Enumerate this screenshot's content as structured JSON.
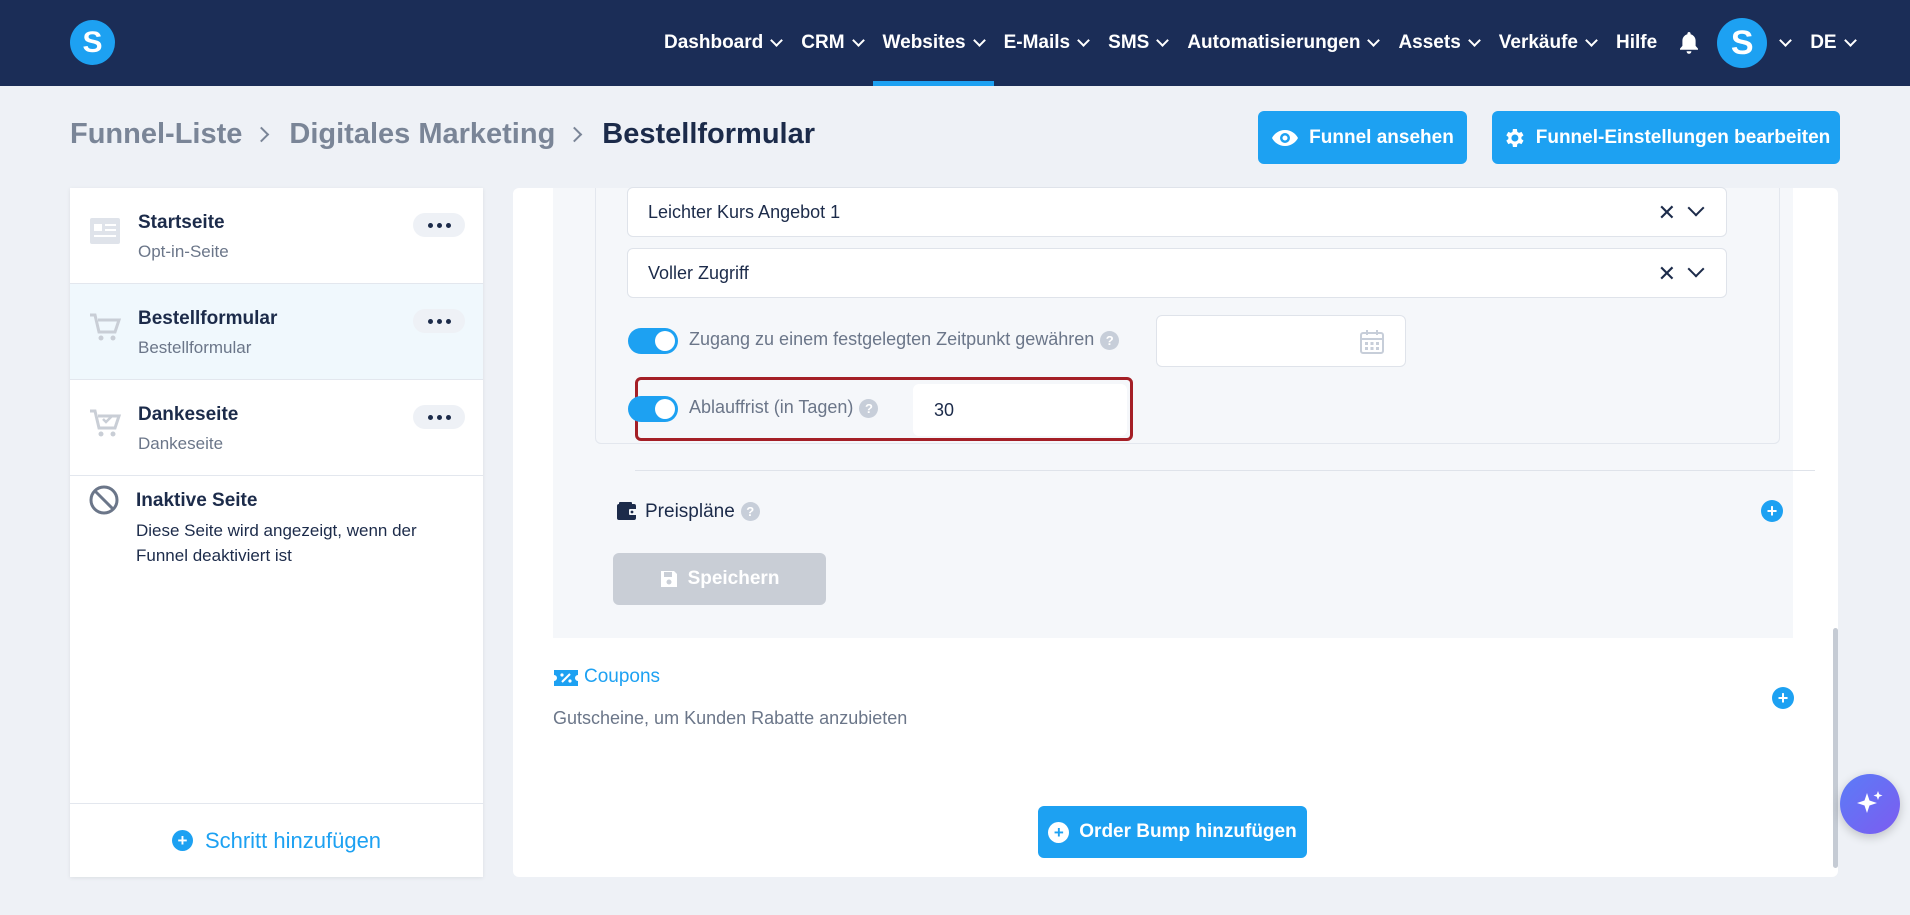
{
  "nav": {
    "items": [
      {
        "label": "Dashboard",
        "has_dropdown": true,
        "active": false
      },
      {
        "label": "CRM",
        "has_dropdown": true,
        "active": false
      },
      {
        "label": "Websites",
        "has_dropdown": true,
        "active": true
      },
      {
        "label": "E-Mails",
        "has_dropdown": true,
        "active": false
      },
      {
        "label": "SMS",
        "has_dropdown": true,
        "active": false
      },
      {
        "label": "Automatisierungen",
        "has_dropdown": true,
        "active": false
      },
      {
        "label": "Assets",
        "has_dropdown": true,
        "active": false
      },
      {
        "label": "Verkäufe",
        "has_dropdown": true,
        "active": false
      },
      {
        "label": "Hilfe",
        "has_dropdown": false,
        "active": false
      }
    ],
    "logo_letter": "S",
    "avatar_letter": "S",
    "language": "DE"
  },
  "breadcrumb": {
    "items": [
      "Funnel-Liste",
      "Digitales Marketing",
      "Bestellformular"
    ]
  },
  "header": {
    "view_funnel_label": "Funnel ansehen",
    "edit_settings_label": "Funnel-Einstellungen bearbeiten"
  },
  "sidebar": {
    "steps": [
      {
        "title": "Startseite",
        "subtitle": "Opt-in-Seite",
        "icon": "page-icon"
      },
      {
        "title": "Bestellformular",
        "subtitle": "Bestellformular",
        "icon": "cart-icon"
      },
      {
        "title": "Dankeseite",
        "subtitle": "Dankeseite",
        "icon": "cart-check-icon"
      }
    ],
    "inactive": {
      "title": "Inaktive Seite",
      "description": "Diese Seite wird angezeigt, wenn der Funnel deaktiviert ist"
    },
    "add_step_label": "Schritt hinzufügen"
  },
  "main": {
    "selects": [
      "Leichter Kurs Angebot 1",
      "Voller Zugriff"
    ],
    "access_toggle_label": "Zugang zu einem festgelegten Zeitpunkt gewähren",
    "access_date_value": "",
    "expiry_toggle_label": "Ablauffrist (in Tagen)",
    "expiry_value": "30",
    "price_plans_label": "Preispläne",
    "save_label": "Speichern",
    "coupons_label": "Coupons",
    "coupons_description": "Gutscheine, um Kunden Rabatte anzubieten",
    "order_bump_label": "Order Bump hinzufügen"
  },
  "colors": {
    "topbar": "#1b2d57",
    "accent": "#1da1f2",
    "highlight_border": "#a41f26"
  }
}
